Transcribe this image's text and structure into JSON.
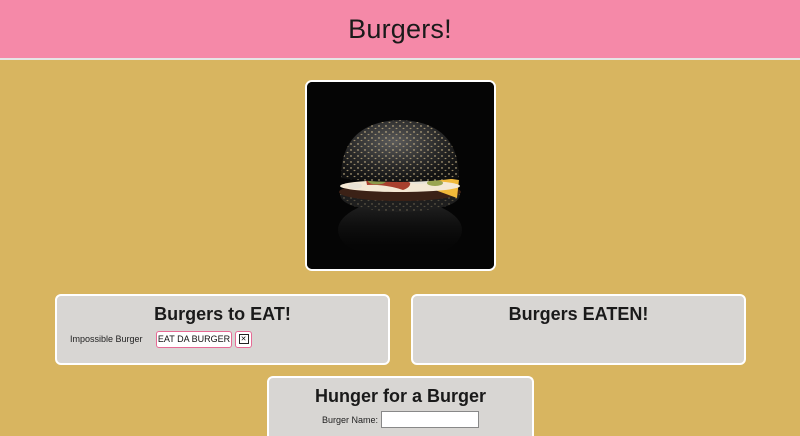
{
  "header": {
    "title": "Burgers!"
  },
  "photo": {
    "alt_icon": "burger-photo"
  },
  "to_eat": {
    "title": "Burgers to EAT!",
    "items": [
      {
        "name": "Impossible Burger",
        "eat_label": "EAT DA BURGER",
        "delete_label": "✕"
      }
    ]
  },
  "eaten": {
    "title": "Burgers EATEN!"
  },
  "form": {
    "title": "Hunger for a Burger",
    "name_label": "Burger Name:",
    "name_value": "",
    "name_placeholder": ""
  },
  "colors": {
    "header_bg": "#f589a8",
    "page_bg": "#d8b560",
    "panel_bg": "#d8d6d3",
    "button_border": "#e76a95"
  }
}
